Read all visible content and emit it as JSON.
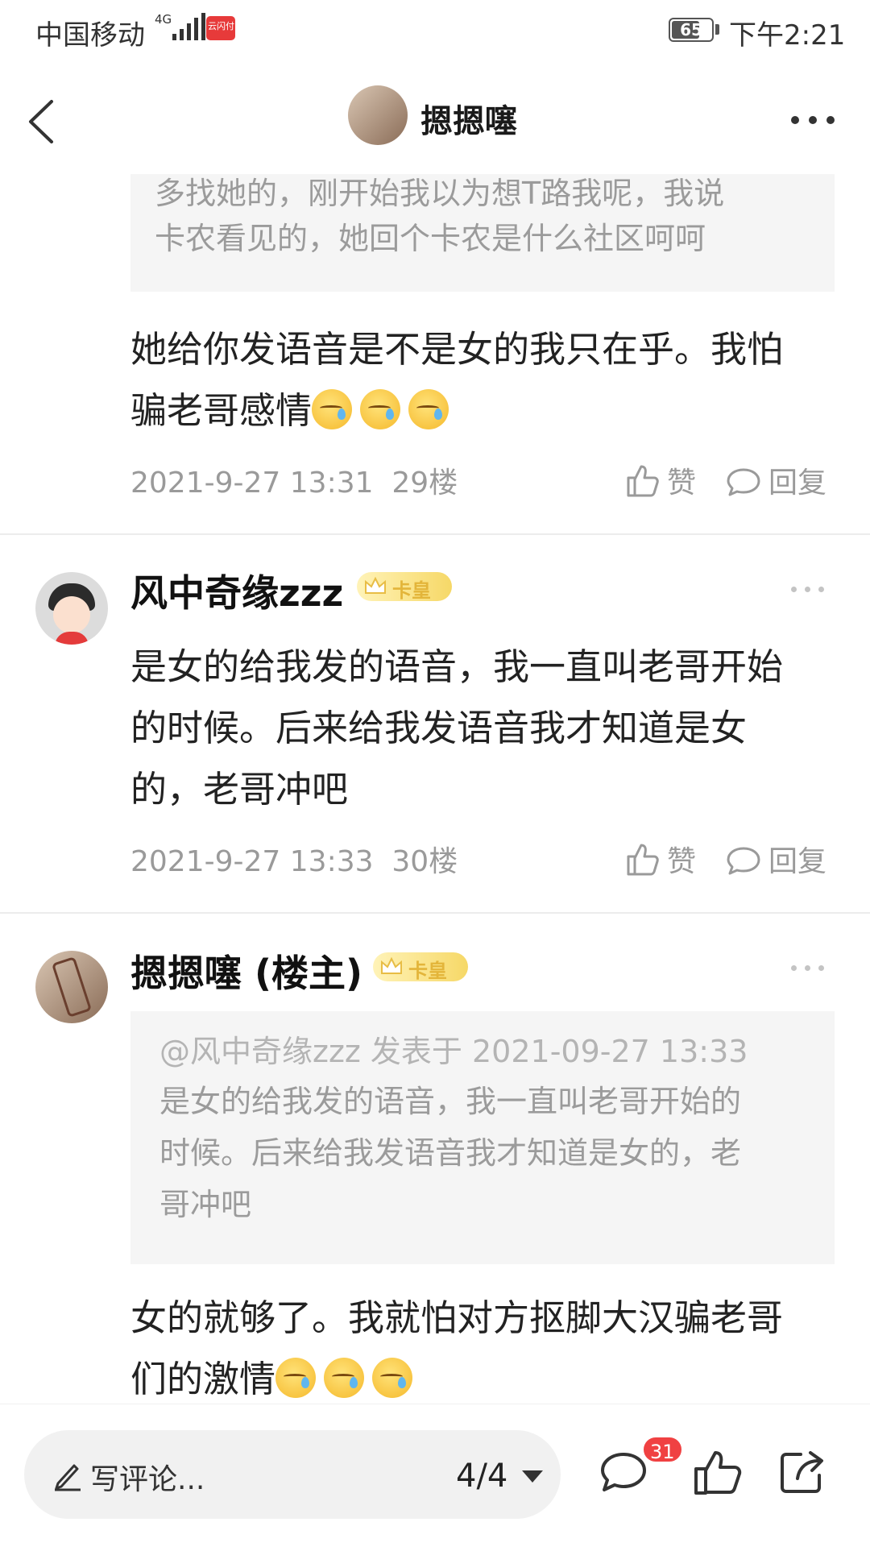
{
  "status_bar": {
    "carrier": "中国移动",
    "network": "4G",
    "pay_icon": "云闪付",
    "battery": "65",
    "time": "下午2:21"
  },
  "header": {
    "title": "摁摁噻"
  },
  "top_quote": {
    "line1": "多找她的，刚开始我以为想T路我呢，我说",
    "line2": "卡农看见的，她回个卡农是什么社区呵呵"
  },
  "posts": [
    {
      "lines": [
        "她给你发语音是不是女的我只在乎。我怕",
        "骗老哥感情"
      ],
      "emoji_count": 3,
      "datetime": "2021-9-27 13:31",
      "floor": "29楼",
      "like_label": "赞",
      "reply_label": "回复"
    },
    {
      "username": "风中奇缘zzz",
      "badge": "卡皇",
      "lines": [
        "是女的给我发的语音，我一直叫老哥开始",
        "的时候。后来给我发语音我才知道是女",
        "的，老哥冲吧"
      ],
      "datetime": "2021-9-27 13:33",
      "floor": "30楼",
      "like_label": "赞",
      "reply_label": "回复"
    },
    {
      "username": "摁摁噻 (楼主)",
      "badge": "卡皇",
      "quote": {
        "head": "@风中奇缘zzz 发表于 2021-09-27 13:33",
        "lines": [
          "是女的给我发的语音，我一直叫老哥开始的",
          "时候。后来给我发语音我才知道是女的，老",
          "哥冲吧"
        ]
      },
      "lines": [
        "女的就够了。我就怕对方抠脚大汉骗老哥",
        "们的激情"
      ],
      "emoji_count": 3
    }
  ],
  "bottom_bar": {
    "placeholder": "写评论...",
    "page_indicator": "4/4",
    "comment_count": "31"
  },
  "colors": {
    "accent_red": "#f04142",
    "badge_gold": "#f6d867",
    "meta_gray": "#9a9a9a"
  },
  "icons": [
    "back-arrow-icon",
    "more-icon",
    "like-icon",
    "reply-icon",
    "pen-icon",
    "comment-icon",
    "share-icon",
    "crown-icon"
  ]
}
